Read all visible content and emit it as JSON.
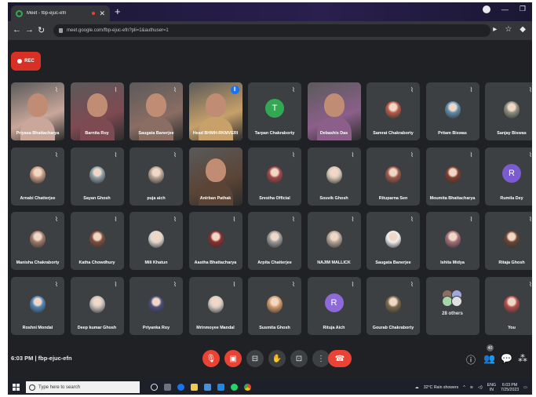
{
  "browser": {
    "tab_title": "Meet - fbp-ejuc-efn",
    "url": "meet.google.com/fbp-ejuc-efn?pli=1&authuser=1"
  },
  "meet": {
    "rec_label": "REC",
    "meeting_time": "6:03 PM",
    "meeting_code": "fbp-ejuc-efn",
    "people_count": "40",
    "participants": [
      {
        "name": "Priyasa Bhattacharya",
        "kind": "video",
        "color": "#c9a79a",
        "mic": "off"
      },
      {
        "name": "Barnita Roy",
        "kind": "video",
        "color": "#7e4a52",
        "mic": "off"
      },
      {
        "name": "Saugata Banerjee",
        "kind": "video",
        "color": "#8a6d63",
        "mic": "off"
      },
      {
        "name": "Head BHMH-RKMVERI",
        "kind": "video",
        "color": "#c7a06a",
        "mic": "on"
      },
      {
        "name": "Tarpan Chakraborty",
        "kind": "letter",
        "letter": "T",
        "color": "#33a852",
        "mic": "off"
      },
      {
        "name": "Debashis Das",
        "kind": "video",
        "color": "#8b5f8a",
        "mic": "none"
      },
      {
        "name": "Samrat Chakraborty",
        "kind": "photo",
        "color": "#b85c4a",
        "mic": "off"
      },
      {
        "name": "Pritam Biswas",
        "kind": "photo",
        "color": "#5f8fae",
        "mic": "off"
      },
      {
        "name": "Sanjay Biswas",
        "kind": "photo",
        "color": "#8d8f80",
        "mic": "off"
      },
      {
        "name": "Arnabi Chatterjee",
        "kind": "photo",
        "color": "#c69a84",
        "mic": "off"
      },
      {
        "name": "Sayan Ghosh",
        "kind": "photo",
        "color": "#8da0a8",
        "mic": "off"
      },
      {
        "name": "puja aich",
        "kind": "photo",
        "color": "#b9a596",
        "mic": "off"
      },
      {
        "name": "Anirban Pathak",
        "kind": "video",
        "color": "#5b4436",
        "mic": "none"
      },
      {
        "name": "Srestha Official",
        "kind": "photo",
        "color": "#a2484b",
        "mic": "off"
      },
      {
        "name": "Souvik Ghosh",
        "kind": "photo",
        "color": "#d8c9b8",
        "mic": "off"
      },
      {
        "name": "Rituparna Sen",
        "kind": "photo",
        "color": "#9c5b4b",
        "mic": "off"
      },
      {
        "name": "Moumita Bhattacharya",
        "kind": "photo",
        "color": "#7e3f2e",
        "mic": "off"
      },
      {
        "name": "Rumila Dey",
        "kind": "letter",
        "letter": "R",
        "color": "#7a5ccf",
        "mic": "off"
      },
      {
        "name": "Manisha Chakraborty",
        "kind": "photo",
        "color": "#a37a6b",
        "mic": "off"
      },
      {
        "name": "Katha Chowdhury",
        "kind": "photo",
        "color": "#7d4f3e",
        "mic": "off"
      },
      {
        "name": "Mili Khatun",
        "kind": "photo",
        "color": "#e0d8d0",
        "mic": "off"
      },
      {
        "name": "Aastha Bhattacharya",
        "kind": "photo",
        "color": "#8b2f2f",
        "mic": "off"
      },
      {
        "name": "Arpita Chatterjee",
        "kind": "photo",
        "color": "#9a9a98",
        "mic": "off"
      },
      {
        "name": "NAJIM MALLICK",
        "kind": "photo",
        "color": "#b5a79b",
        "mic": "off"
      },
      {
        "name": "Saugata Banerjee",
        "kind": "photo",
        "color": "#f1f1f1",
        "mic": "off"
      },
      {
        "name": "Ishita Midya",
        "kind": "photo",
        "color": "#a36f7a",
        "mic": "off"
      },
      {
        "name": "Ritaja Ghosh",
        "kind": "photo",
        "color": "#6b4536",
        "mic": "off"
      },
      {
        "name": "Roshni Mondal",
        "kind": "photo",
        "color": "#4f86b8",
        "mic": "off"
      },
      {
        "name": "Deep kumar Ghosh",
        "kind": "photo",
        "color": "#c6c1be",
        "mic": "off"
      },
      {
        "name": "Priyanka Roy",
        "kind": "photo",
        "color": "#4a4f7a",
        "mic": "off"
      },
      {
        "name": "Mrinmoyee Mandal",
        "kind": "photo",
        "color": "#d9cfc6",
        "mic": "off"
      },
      {
        "name": "Susmita Ghosh",
        "kind": "photo",
        "color": "#d49a6a",
        "mic": "off"
      },
      {
        "name": "Rituja Aich",
        "kind": "letter",
        "letter": "R",
        "color": "#8e6ad8",
        "mic": "off"
      },
      {
        "name": "Gourab Chakraborty",
        "kind": "photo",
        "color": "#7a6a4a",
        "mic": "off"
      },
      {
        "name": "28 others",
        "kind": "others",
        "color": "#5f6368",
        "mic": "none"
      },
      {
        "name": "You",
        "kind": "photo",
        "color": "#b34d4d",
        "mic": "off"
      }
    ]
  },
  "taskbar": {
    "search_placeholder": "Type here to search",
    "weather": "32°C  Rain showers",
    "lang_line1": "ENG",
    "lang_line2": "IN",
    "time": "6:03 PM",
    "date": "7/25/2023"
  },
  "colors": {
    "meet_bg": "#202124",
    "tile_bg": "#3c4043",
    "danger": "#ea4335",
    "accent": "#1a73e8"
  }
}
